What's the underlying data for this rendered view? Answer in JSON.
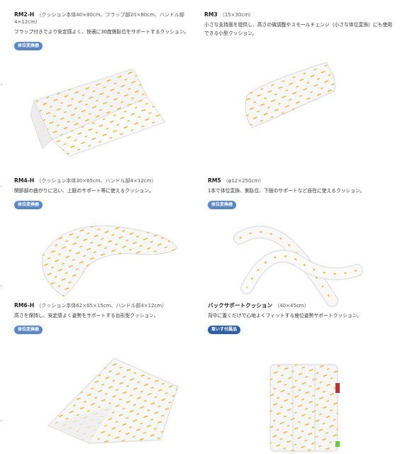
{
  "products": [
    {
      "model": "RM2-H",
      "dims": "（クッション本体40×80cm、フラップ部20×80cm、ハンドル部4×12cm）",
      "desc": "フラップ付きでより安定感よく、快適に30度側臥位をサポートするクッション。",
      "badge": "体位変換器",
      "image": "flap-cushion"
    },
    {
      "model": "RM3",
      "dims": "（15×30cm）",
      "desc": "小さな支持面を提供し、高さの微調整やスモールチェンジ（小さな体位変換）にも使用できる小型クッション。",
      "badge": "",
      "image": "small-pillow"
    },
    {
      "model": "RM4-H",
      "dims": "（クッション本体30×65cm、ハンドル部4×12cm）",
      "desc": "関節部の曲がりに沿い、上肢のサポート等に使えるクッション。",
      "badge": "体位変換器",
      "image": "crescent-cushion"
    },
    {
      "model": "RM5",
      "dims": "（φ12×250cm）",
      "desc": "1本で体位変換、側臥位、下肢のサポートなど自在に使えるクッション。",
      "badge": "体位変換器",
      "image": "long-tube-cushion"
    },
    {
      "model": "RM6-H",
      "dims": "（クッション本体62×65×15cm、ハンドル部4×12cm）",
      "desc": "高さを保持し、安定感よく姿勢をサポートする台形型クッション。",
      "badge": "体位変換器",
      "image": "trapezoid-cushion"
    },
    {
      "model": "バックサポートクッション",
      "dims": "（40×45cm）",
      "desc": "背中に置くだけで心地よくフィットする座位姿勢サポートクッション。",
      "badge": "車いす付属品",
      "image": "back-support-cushion"
    }
  ],
  "colors": {
    "badge": "#5b86c4",
    "badge_alt": "#2f5fa8",
    "accent": "#f0b44a",
    "cushion": "#f7f7f7"
  }
}
